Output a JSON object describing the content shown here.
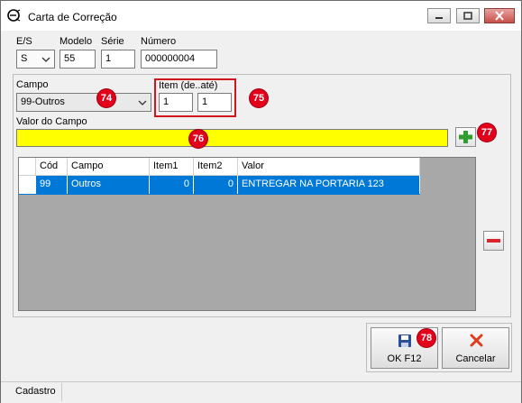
{
  "window": {
    "title": "Carta de Correção"
  },
  "fields": {
    "es_label": "E/S",
    "es_value": "S",
    "modelo_label": "Modelo",
    "modelo_value": "55",
    "serie_label": "Série",
    "serie_value": "1",
    "numero_label": "Número",
    "numero_value": "000000004",
    "campo_label": "Campo",
    "campo_value": "99-Outros",
    "item_label": "Item (de..até)",
    "item_de": "1",
    "item_ate": "1",
    "valor_label": "Valor do Campo",
    "valor_value": ""
  },
  "markers": [
    "74",
    "75",
    "76",
    "77",
    "78"
  ],
  "table": {
    "headers": [
      "Cód",
      "Campo",
      "Item1",
      "Item2",
      "Valor"
    ],
    "rows": [
      [
        "99",
        "Outros",
        "0",
        "0",
        "ENTREGAR NA PORTARIA 123"
      ]
    ]
  },
  "buttons": {
    "ok_label": "OK  F12",
    "cancel_label": "Cancelar"
  },
  "status": {
    "tab_label": "Cadastro"
  },
  "colors": {
    "highlight": "#0078d7",
    "field_yellow": "#ffff00",
    "marker_red": "#e2001a"
  }
}
